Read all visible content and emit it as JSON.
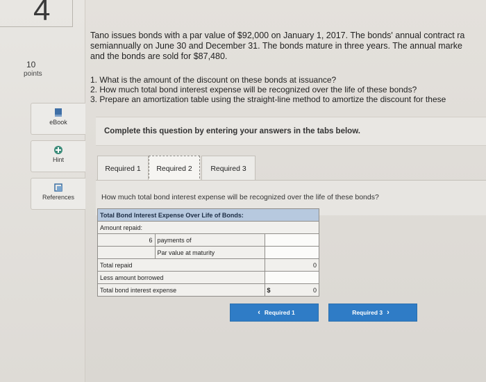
{
  "question": {
    "number": "4",
    "points_value": "10",
    "points_label": "points",
    "intro_lines": [
      "Tano issues bonds with a par value of $92,000 on January 1, 2017. The bonds' annual contract ra",
      "semiannually on June 30 and December 31. The bonds mature in three years. The annual marke",
      "and the bonds are sold for $87,480."
    ],
    "items": [
      "1. What is the amount of the discount on these bonds at issuance?",
      "2. How much total bond interest expense will be recognized over the life of these bonds?",
      "3. Prepare an amortization table using the straight-line method to amortize the discount for these"
    ]
  },
  "sidebar": {
    "ebook_label": "eBook",
    "hint_label": "Hint",
    "references_label": "References"
  },
  "instructions": "Complete this question by entering your answers in the tabs below.",
  "tabs": [
    {
      "label": "Required 1"
    },
    {
      "label": "Required 2"
    },
    {
      "label": "Required 3"
    }
  ],
  "tab_question": "How much total bond interest expense will be recognized over the life of these bonds?",
  "table": {
    "header": "Total Bond Interest Expense Over Life of Bonds:",
    "amount_repaid_label": "Amount repaid:",
    "payments_count": "6",
    "payments_label": "payments of",
    "par_value_label": "Par value at maturity",
    "total_repaid_label": "Total repaid",
    "total_repaid_value": "0",
    "less_borrowed_label": "Less amount borrowed",
    "total_interest_label": "Total bond interest expense",
    "currency_symbol": "$",
    "total_interest_value": "0"
  },
  "nav": {
    "prev_label": "Required 1",
    "next_label": "Required 3"
  },
  "colors": {
    "accent": "#2f7cc6",
    "table_header": "#b7c9df"
  }
}
